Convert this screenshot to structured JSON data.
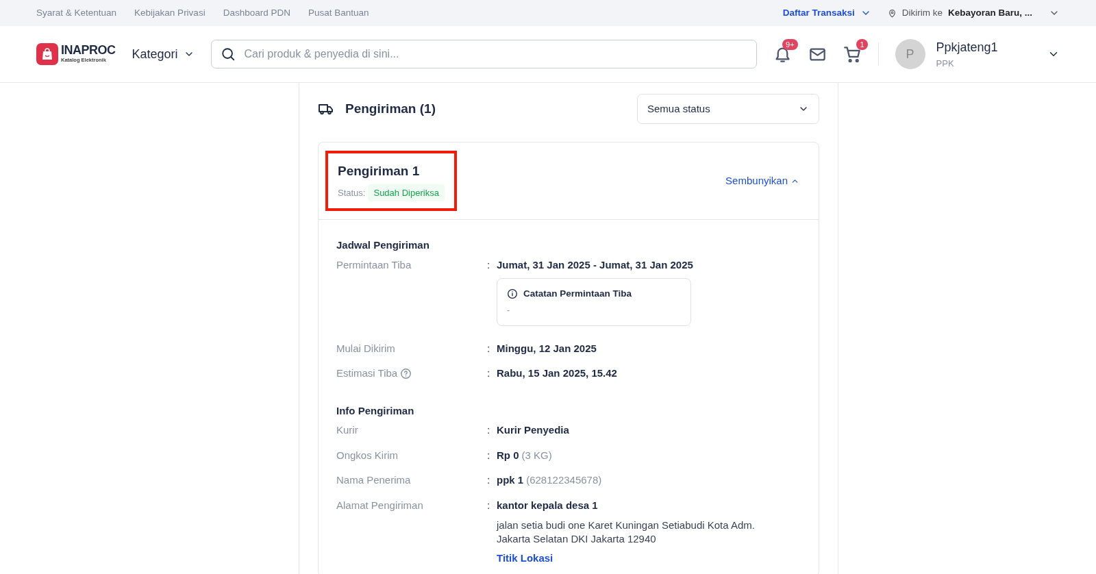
{
  "top_bar": {
    "links": [
      "Syarat & Ketentuan",
      "Kebijakan Privasi",
      "Dashboard PDN",
      "Pusat Bantuan"
    ],
    "transactions": "Daftar Transaksi",
    "ship_to_label": "Dikirim ke",
    "ship_to_value": "Kebayoran Baru, ..."
  },
  "header": {
    "logo_title": "INAPROC",
    "logo_subtitle": "Katalog Elektronik",
    "category": "Kategori",
    "search": {
      "placeholder": "Cari produk & penyedia di sini..."
    },
    "notification_badge": "9+",
    "cart_badge": "1",
    "user": {
      "initial": "P",
      "name": "Ppkjateng1",
      "role": "PPK"
    }
  },
  "shipping": {
    "title": "Pengiriman (1)",
    "filter": "Semua status",
    "shipments": [
      {
        "title": "Pengiriman 1",
        "status_label": "Status:",
        "status": "Sudah Diperiksa",
        "highlighted": true,
        "toggle": "Sembunyikan",
        "expanded": true,
        "sections": [
          {
            "title": "Jadwal Pengiriman",
            "rows": [
              {
                "label": "Permintaan Tiba",
                "help": false,
                "separator": ":",
                "value": "Jumat, 31 Jan 2025 - Jumat, 31 Jan 2025",
                "note": {
                  "title": "Catatan Permintaan Tiba",
                  "text": "-"
                }
              },
              {
                "label": "Mulai Dikirim",
                "help": false,
                "separator": ":",
                "value": "Minggu, 12 Jan 2025"
              },
              {
                "label": "Estimasi Tiba",
                "help": true,
                "separator": ":",
                "value": "Rabu, 15 Jan 2025, 15.42"
              }
            ]
          },
          {
            "title": "Info Pengiriman",
            "rows": [
              {
                "label": "Kurir",
                "help": false,
                "separator": ":",
                "value": "Kurir Penyedia"
              },
              {
                "label": "Ongkos Kirim",
                "help": false,
                "separator": ":",
                "value": "Rp 0",
                "suffix": "(3 KG)"
              },
              {
                "label": "Nama Penerima",
                "help": false,
                "separator": ":",
                "value": "ppk 1",
                "suffix": "(628122345678)"
              },
              {
                "label": "Alamat Pengiriman",
                "help": false,
                "separator": ":",
                "value": "kantor kepala desa 1",
                "detail": "jalan setia budi one Karet Kuningan Setiabudi Kota Adm. Jakarta Selatan DKI Jakarta 12940",
                "link": "Titik Lokasi"
              }
            ]
          }
        ]
      }
    ]
  }
}
